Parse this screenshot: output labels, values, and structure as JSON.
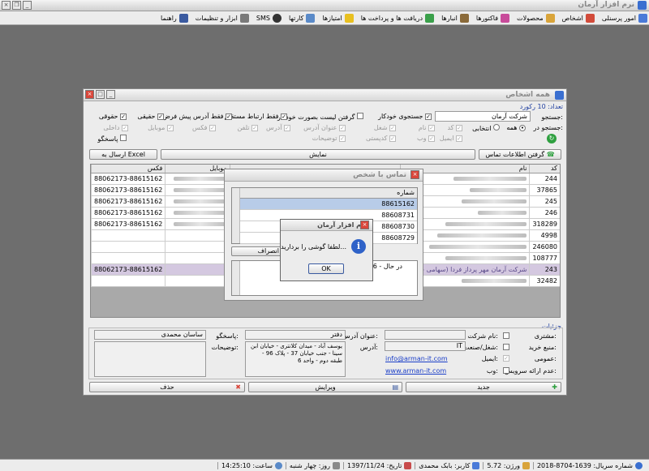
{
  "app": {
    "title": "نرم افزار آرمان"
  },
  "menu": [
    "امور پرسنلی",
    "اشخاص",
    "محصولات",
    "فاکتورها",
    "انبارها",
    "دریافت ها و پرداخت ها",
    "امتیازها",
    "کارتها",
    "SMS",
    "ابزار و تنظیمات",
    "راهنما"
  ],
  "status": {
    "serial": "شماره سریال: 1639-8704-2018",
    "version": "ورژن: 5.72",
    "user": "کاربر: بابک محمدی",
    "date": "تاریخ: 1397/11/24",
    "day": "روز: چهار شنبه",
    "time": "ساعت: 14:25:10"
  },
  "persons": {
    "title": "همه اشخاص",
    "count": "تعداد: 10 رکورد",
    "search_label": "جستجو:",
    "search_value": "شرکت آرمان",
    "auto_search": "جستجوی خودکار",
    "auto_list": "گرفتن لیست بصورت خودکار",
    "direct_only": "فقط ارتباط مستقیم",
    "default_addr": "فقط آدرس پیش فرض",
    "legal": "حقیقی",
    "juridical": "حقوقی",
    "search_in": "جستجو در:",
    "all": "همه",
    "optional": "انتخابی",
    "fields": [
      "کد",
      "نام",
      "شغل",
      "عنوان آدرس",
      "آدرس",
      "تلفن",
      "فکس",
      "موبایل",
      "داخلی"
    ],
    "fields2": [
      "ایمیل",
      "وب",
      "کدپستی",
      "توضیحات",
      "پاسخگو"
    ],
    "get_contacts": "گرفتن اطلاعات تماس",
    "show": "نمایش",
    "excel": "ارسال به Excel",
    "cols": {
      "code": "کد",
      "name": "نام",
      "mobile": "موبایل",
      "fax": "فکس"
    },
    "rows": [
      {
        "code": "244",
        "fax": "88062173-88615162"
      },
      {
        "code": "37865",
        "fax": "88062173-88615162"
      },
      {
        "code": "245",
        "fax": "88062173-88615162"
      },
      {
        "code": "246",
        "fax": "88062173-88615162"
      },
      {
        "code": "318289",
        "fax": "88062173-88615162"
      },
      {
        "code": "4998",
        "fax": ""
      },
      {
        "code": "246080",
        "fax": ""
      },
      {
        "code": "108777",
        "fax": ""
      },
      {
        "code": "243",
        "fax": "88062173-88615162",
        "name": "شرکت آرمان مهر پرداز فردا (سهامی خاص)"
      },
      {
        "code": "32482",
        "fax": ""
      }
    ],
    "details_label": "جزئیات",
    "customer": "مشتری:",
    "company_name": "نام شرکت:",
    "buy_source": "منبع خرید:",
    "job": "شغل/صنعت:",
    "job_value": "IT",
    "general": "عمومی:",
    "email": "ایمیل:",
    "email_value": "info@arman-it.com",
    "no_service": "عدم ارائه سرویس:",
    "web": "وب:",
    "web_value": "www.arman-it.com",
    "address_title": "عنوان آدرس:",
    "address_title_value": "دفتر",
    "address": "آدرس:",
    "address_value": "یوسف آباد - میدان کلانتری - خیابان ابن سینا - جنب خیابان 37 - پلاک 96 - طبقه دوم - واحد 6",
    "responder": "پاسخگو:",
    "responder_value": "ساسان محمدی",
    "notes": "توضیحات:",
    "new": "جدید",
    "edit": "ویرایش",
    "delete": "حذف"
  },
  "contact": {
    "title": "تماس با شخص",
    "col": "شماره",
    "numbers": [
      "88615162",
      "88608731",
      "88608730",
      "88608729"
    ],
    "cancel": "انصراف",
    "log": "14:25:06 - در حال"
  },
  "dialog": {
    "title": "نرم افزار آرمان",
    "message": "لطفا گوشی را بردارید...",
    "ok": "OK"
  }
}
